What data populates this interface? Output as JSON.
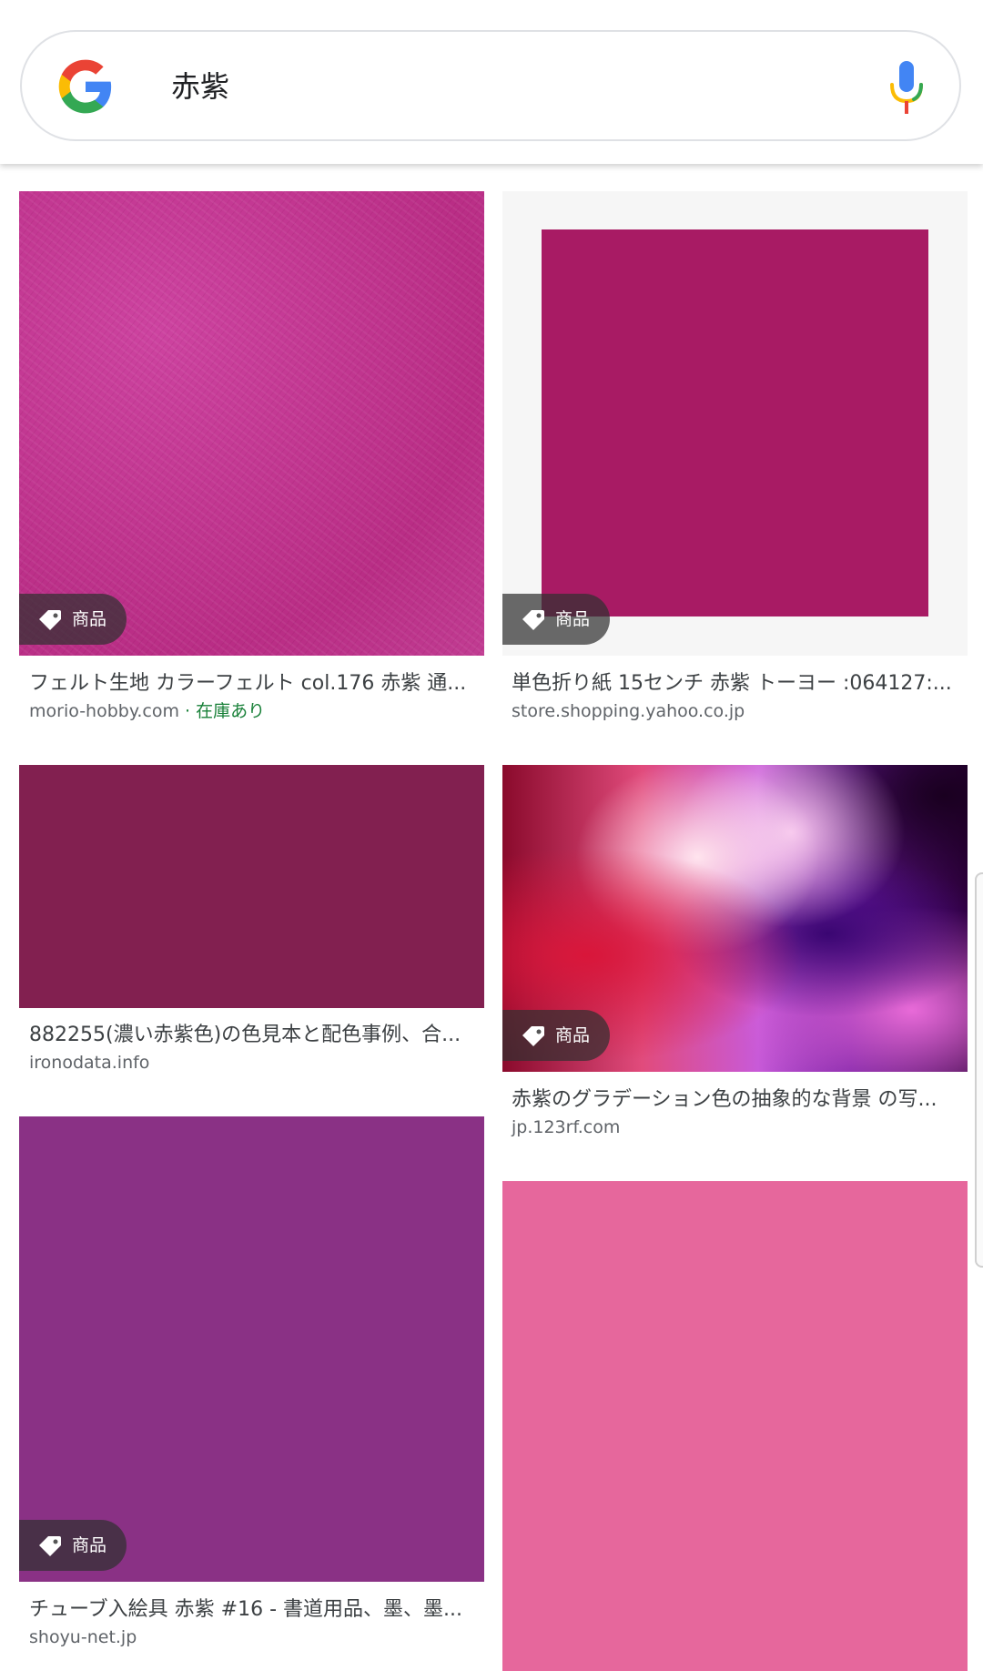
{
  "search": {
    "query": "赤紫"
  },
  "icons": {
    "logo": "google-logo",
    "mic": "microphone-icon",
    "tag": "tag-icon"
  },
  "colors": {
    "felt": "#c7398f",
    "origami": "#a81b64",
    "deep": "#822050",
    "tube": "#8a3185",
    "pink": "#e6679c",
    "stock_green": "#188038"
  },
  "results": [
    {
      "title": "フェルト生地 カラーフェルト col.176 赤紫 通...",
      "domain": "morio-hobby.com",
      "separator": " · ",
      "availability": "在庫あり",
      "badge": "商品"
    },
    {
      "title": "単色折り紙 15センチ 赤紫 トーヨー :064127:...",
      "domain": "store.shopping.yahoo.co.jp",
      "badge": "商品"
    },
    {
      "title": "882255(濃い赤紫色)の色見本と配色事例、合...",
      "domain": "ironodata.info"
    },
    {
      "title": "赤紫のグラデーション色の抽象的な背景 の写...",
      "domain": "jp.123rf.com",
      "badge": "商品"
    },
    {
      "title": "チューブ入絵具 赤紫 #16 - 書道用品、墨、墨...",
      "domain": "shoyu-net.jp",
      "badge": "商品"
    },
    {
      "title": "",
      "domain": ""
    }
  ]
}
